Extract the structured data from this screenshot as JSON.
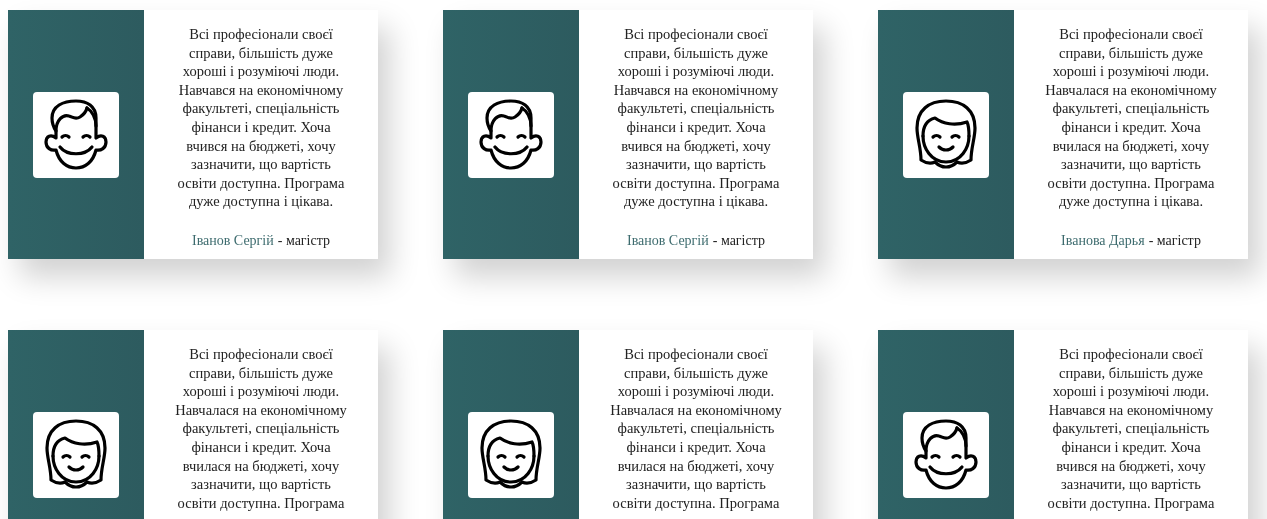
{
  "cards": [
    {
      "kind": "boy",
      "text": "Всі професіонали своєї справи, більшість дуже хороші і розуміючі люди. Навчався на економічному факультеті, спеціальність фінанси і кредит. Хоча вчився на бюджеті, хочу зазначити, що вартість освіти доступна. Програма дуже доступна і цікава.",
      "author": "Іванов Сергій",
      "role": "- магістр"
    },
    {
      "kind": "boy",
      "text": "Всі професіонали своєї справи, більшість дуже хороші і розуміючі люди. Навчався на економічному факультеті, спеціальність фінанси і кредит. Хоча вчився на бюджеті, хочу зазначити, що вартість освіти доступна. Програма дуже доступна і цікава.",
      "author": "Іванов Сергій",
      "role": "- магістр"
    },
    {
      "kind": "girl",
      "text": "Всі професіонали своєї справи, більшість дуже хороші і розуміючі люди. Навчалася на економічному факультеті, спеціальність фінанси і кредит. Хоча вчилася на бюджеті, хочу зазначити, що вартість освіти доступна. Програма дуже доступна і цікава.",
      "author": "Іванова Дарья",
      "role": "- магістр"
    },
    {
      "kind": "girl",
      "text": "Всі професіонали своєї справи, більшість дуже хороші і розуміючі люди. Навчалася на економічному факультеті, спеціальність фінанси і кредит. Хоча вчилася на бюджеті, хочу зазначити, що вартість освіти доступна. Програма"
    },
    {
      "kind": "girl",
      "text": "Всі професіонали своєї справи, більшість дуже хороші і розуміючі люди. Навчалася на економічному факультеті, спеціальність фінанси і кредит. Хоча вчилася на бюджеті, хочу зазначити, що вартість освіти доступна. Програма"
    },
    {
      "kind": "boy",
      "text": "Всі професіонали своєї справи, більшість дуже хороші і розуміючі люди. Навчався на економічному факультеті, спеціальність фінанси і кредит. Хоча вчився на бюджеті, хочу зазначити, що вартість освіти доступна. Програма"
    }
  ]
}
